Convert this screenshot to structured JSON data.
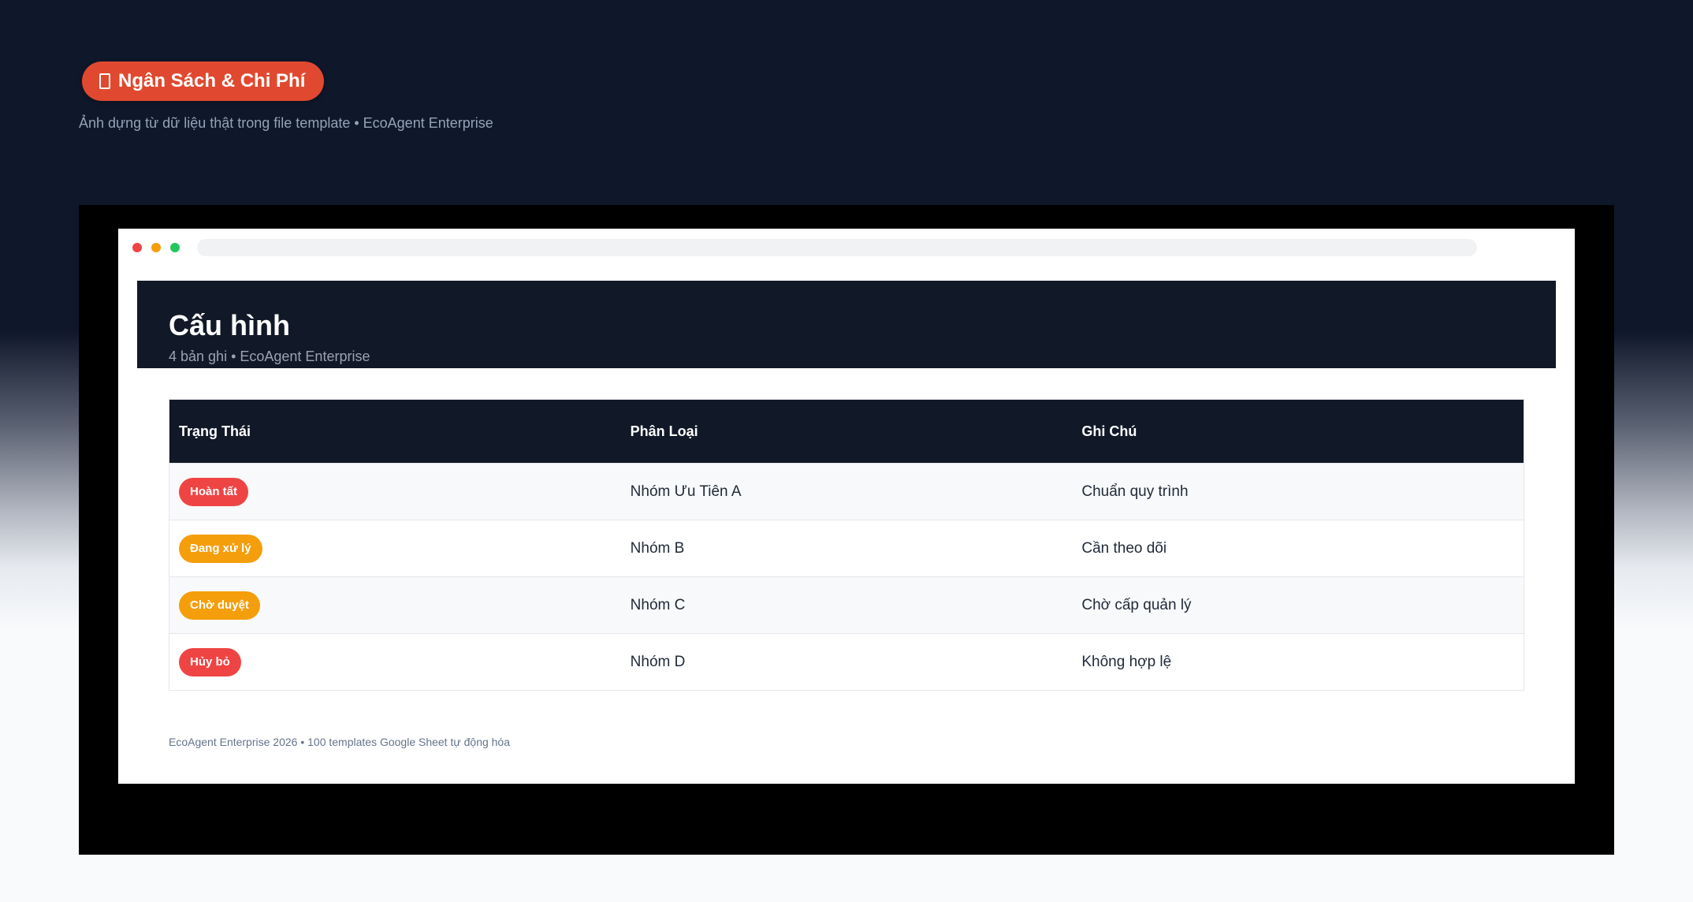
{
  "badge": {
    "icon": "document-icon",
    "label": "Ngân Sách & Chi Phí",
    "color": "#e0492f"
  },
  "subtitle": "Ảnh dựng từ dữ liệu thật trong file template • EcoAgent Enterprise",
  "window": {
    "header": {
      "title": "Cấu hình",
      "subtitle": "4 bản ghi • EcoAgent Enterprise"
    },
    "table": {
      "columns": [
        "Trạng Thái",
        "Phân Loại",
        "Ghi Chú"
      ],
      "rows": [
        {
          "status": "Hoàn tất",
          "status_color": "#ef4444",
          "category": "Nhóm Ưu Tiên A",
          "note": "Chuẩn quy trình"
        },
        {
          "status": "Đang xử lý",
          "status_color": "#f59e0b",
          "category": "Nhóm B",
          "note": "Cần theo dõi"
        },
        {
          "status": "Chờ duyệt",
          "status_color": "#f59e0b",
          "category": "Nhóm C",
          "note": "Chờ cấp quản lý"
        },
        {
          "status": "Hủy bỏ",
          "status_color": "#ef4444",
          "category": "Nhóm D",
          "note": "Không hợp lệ"
        }
      ]
    },
    "footer": "EcoAgent Enterprise 2026 • 100 templates Google Sheet tự động hóa"
  }
}
